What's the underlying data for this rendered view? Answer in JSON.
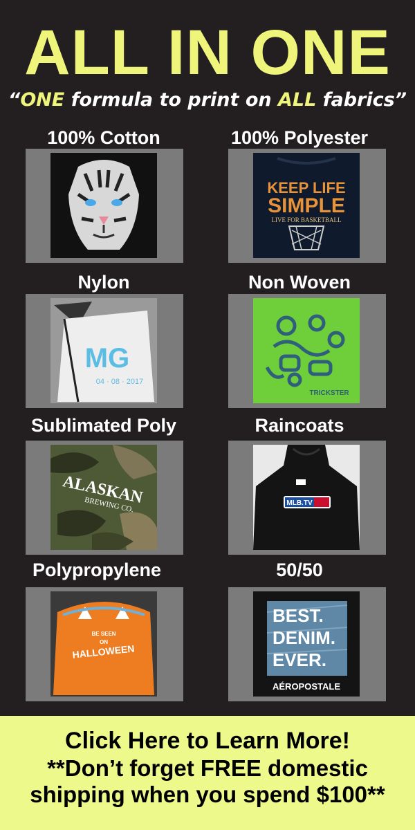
{
  "header": {
    "title": "ALL IN ONE",
    "subtitle_open": "“",
    "subtitle_one": "ONE",
    "subtitle_mid": " formula to print on ",
    "subtitle_all": "ALL",
    "subtitle_end": " fabrics”"
  },
  "fabrics": [
    {
      "label": "100% Cotton",
      "image": "white-tiger-tshirt"
    },
    {
      "label": "100% Polyester",
      "image": "basketball-tshirt"
    },
    {
      "label": "Nylon",
      "image": "drawstring-bag"
    },
    {
      "label": "Non Woven",
      "image": "green-bag"
    },
    {
      "label": "Sublimated Poly",
      "image": "camo-hoodie"
    },
    {
      "label": "Raincoats",
      "image": "black-hoodie"
    },
    {
      "label": "Polypropylene",
      "image": "pumpkin-bag"
    },
    {
      "label": "50/50",
      "image": "denim-print-tee"
    }
  ],
  "photo_text": {
    "polyester_line1": "KEEP LIFE",
    "polyester_line2": "SIMPLE",
    "polyester_line3": "LIVE FOR BASKETBALL",
    "nylon_logo": "MG",
    "nylon_date": "04 · 08 · 2017",
    "nonwoven_brand": "TRICKSTER",
    "camo_line1": "ALASKAN",
    "camo_line2": "BREWING CO.",
    "raincoat_logo": "MLB.TV",
    "pumpkin_line1": "BE SEEN",
    "pumpkin_line2": "ON",
    "pumpkin_line3": "HALLOWEEN",
    "denim_line1": "BEST.",
    "denim_line2": "DENIM.",
    "denim_line3": "EVER.",
    "denim_brand": "AÉROPOSTALE"
  },
  "footer": {
    "cta": "Click Here to Learn More!",
    "note_line1": "**Don’t forget FREE domestic",
    "note_line2": "shipping when you spend $100**"
  },
  "colors": {
    "background": "#231f20",
    "accent_yellow": "#eef57a",
    "footer_bg": "#eef98c",
    "tile_gray": "#7b7b7b"
  }
}
